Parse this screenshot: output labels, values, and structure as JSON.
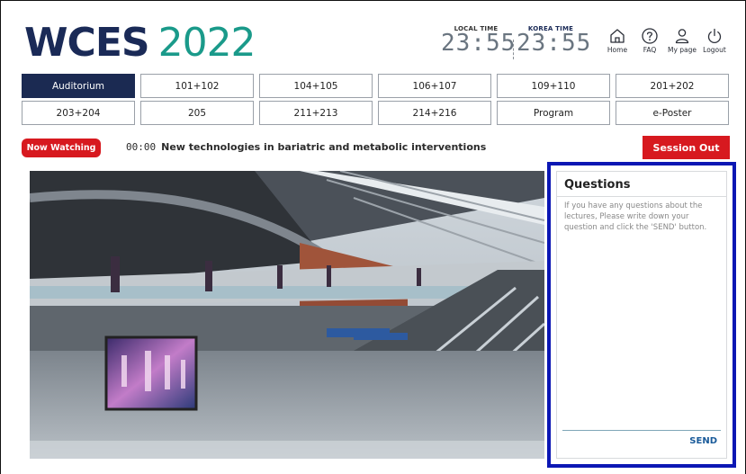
{
  "logo": {
    "wordmark": "WCES",
    "year": "2022"
  },
  "clocks": {
    "local": {
      "caption": "LOCAL TIME",
      "time": "23:55"
    },
    "korea": {
      "caption": "KOREA TIME",
      "time": "23:55"
    }
  },
  "topnav": [
    {
      "label": "Home",
      "icon": "home-icon"
    },
    {
      "label": "FAQ",
      "icon": "question-icon"
    },
    {
      "label": "My page",
      "icon": "user-icon"
    },
    {
      "label": "Logout",
      "icon": "power-icon"
    }
  ],
  "rooms": [
    {
      "label": "Auditorium",
      "active": true
    },
    {
      "label": "101+102"
    },
    {
      "label": "104+105"
    },
    {
      "label": "106+107"
    },
    {
      "label": "109+110"
    },
    {
      "label": "201+202"
    },
    {
      "label": "203+204"
    },
    {
      "label": "205"
    },
    {
      "label": "211+213"
    },
    {
      "label": "214+216"
    },
    {
      "label": "Program"
    },
    {
      "label": "e-Poster"
    }
  ],
  "now_watching": {
    "badge": "Now Watching",
    "timestamp": "00:00",
    "title": "New technologies in bariatric and metabolic interventions"
  },
  "session_out": "Session Out",
  "questions": {
    "title": "Questions",
    "instructions": "If you have any questions about the lectures, Please write down your question and click the 'SEND' button.",
    "send": "SEND"
  },
  "colors": {
    "navy": "#1b2a52",
    "teal": "#1a9a8a",
    "red": "#d7191f",
    "highlight_border": "#0c17b4"
  }
}
